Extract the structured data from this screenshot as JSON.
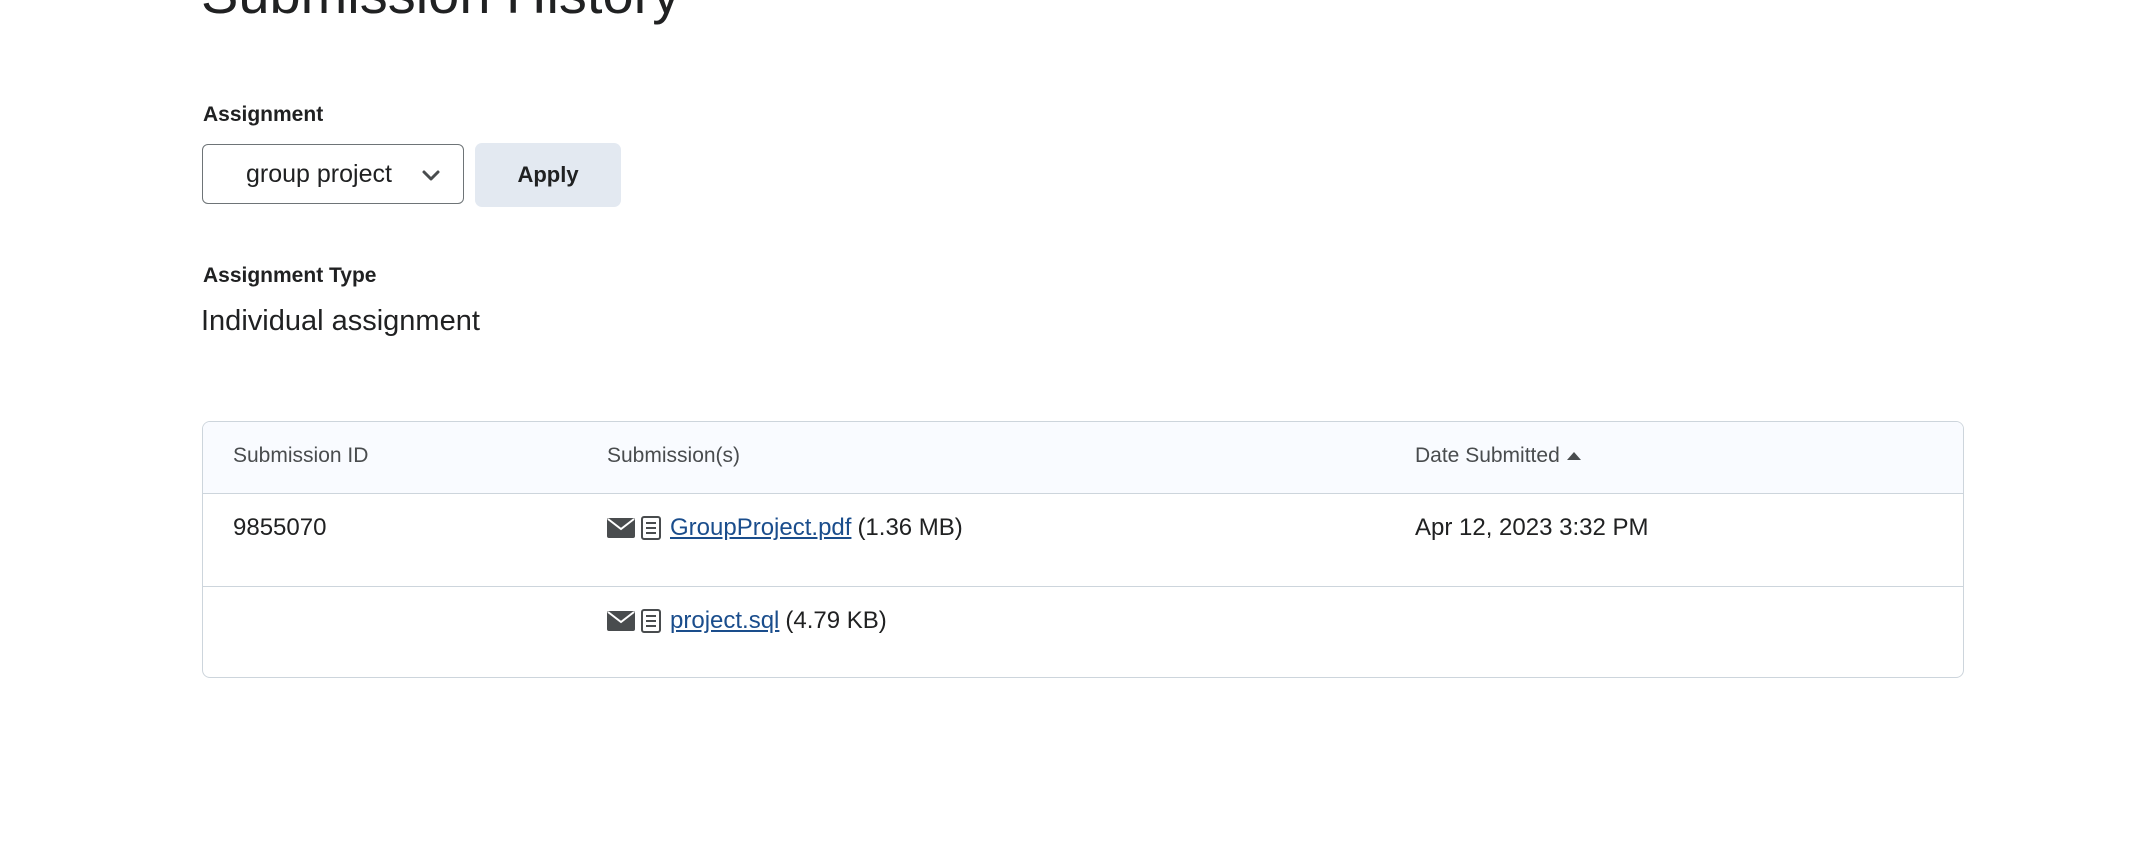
{
  "page": {
    "title": "Submission History"
  },
  "filter": {
    "assignment_label": "Assignment",
    "assignment_selected": "group project",
    "apply_label": "Apply"
  },
  "assignment_type": {
    "label": "Assignment Type",
    "value": "Individual assignment"
  },
  "table": {
    "headers": {
      "submission_id": "Submission ID",
      "submissions": "Submission(s)",
      "date_submitted": "Date Submitted"
    },
    "sort": {
      "column": "date_submitted",
      "direction": "ascending"
    },
    "rows": [
      {
        "submission_id": "9855070",
        "file_name": "GroupProject.pdf",
        "file_size": "(1.36 MB)",
        "date_submitted": "Apr 12, 2023 3:32 PM"
      },
      {
        "submission_id": "",
        "file_name": "project.sql",
        "file_size": "(4.79 KB)",
        "date_submitted": ""
      }
    ]
  },
  "icons": {
    "mail": "mail-icon",
    "file": "file-icon",
    "chevron": "chevron-down-icon",
    "sort": "sort-ascending-icon"
  },
  "colors": {
    "link": "#1a4d8c",
    "apply_button_bg": "#e3e9f1",
    "header_bg": "#f9fbff",
    "border": "#cdd5dc"
  }
}
